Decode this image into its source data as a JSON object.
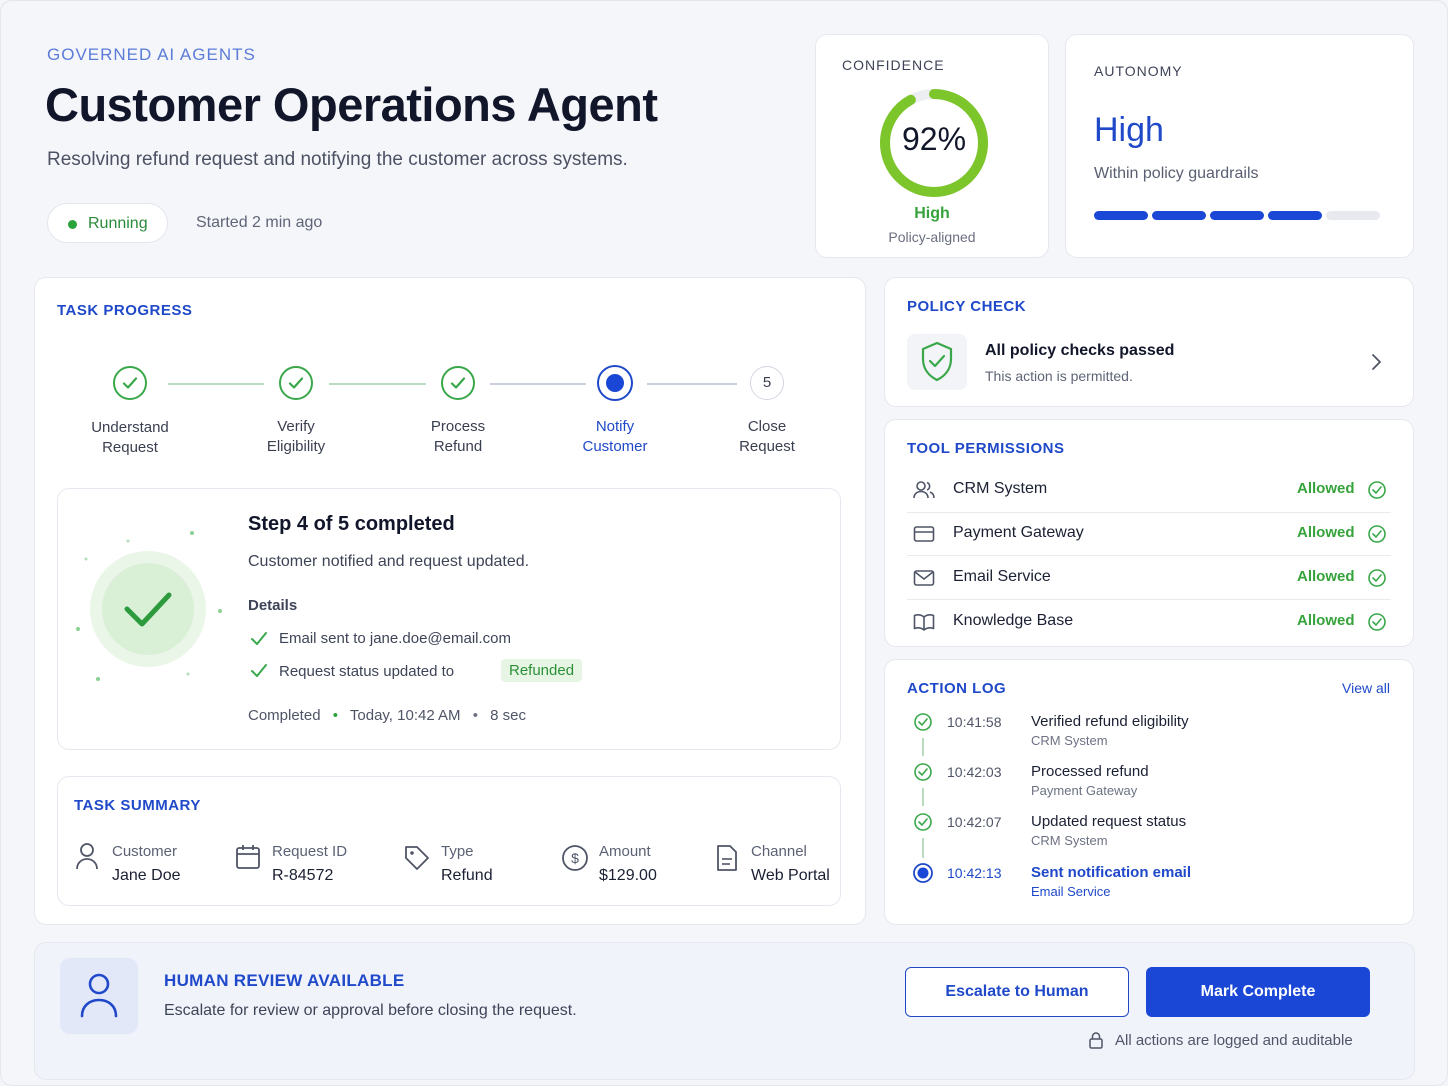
{
  "header": {
    "eyebrow": "GOVERNED AI AGENTS",
    "title": "Customer Operations Agent",
    "subtitle": "Resolving refund request and notifying the customer across systems.",
    "status": "Running",
    "started": "Started 2 min ago"
  },
  "confidence": {
    "title": "CONFIDENCE",
    "value": "92%",
    "fraction": 0.92,
    "level": "High",
    "sub": "Policy-aligned"
  },
  "autonomy": {
    "title": "AUTONOMY",
    "value": "High",
    "sub": "Within policy guardrails",
    "segments_filled": 4,
    "segments_total": 5
  },
  "progress": {
    "title": "TASK PROGRESS",
    "steps": [
      {
        "line1": "Understand",
        "line2": "Request",
        "state": "done"
      },
      {
        "line1": "Verify",
        "line2": "Eligibility",
        "state": "done"
      },
      {
        "line1": "Process",
        "line2": "Refund",
        "state": "done"
      },
      {
        "line1": "Notify",
        "line2": "Customer",
        "state": "active"
      },
      {
        "line1": "Close",
        "line2": "Request",
        "state": "pending",
        "number": "5"
      }
    ],
    "detail": {
      "heading": "Step 4 of 5 completed",
      "desc": "Customer notified and request updated.",
      "details_label": "Details",
      "item1": "Email sent to jane.doe@email.com",
      "item2": "Request status updated to",
      "item2_badge": "Refunded",
      "completed": "Completed",
      "time": "Today, 10:42 AM",
      "duration": "8 sec"
    }
  },
  "summary": {
    "title": "TASK SUMMARY",
    "customer_label": "Customer",
    "customer_value": "Jane Doe",
    "request_label": "Request ID",
    "request_value": "R-84572",
    "type_label": "Type",
    "type_value": "Refund",
    "amount_label": "Amount",
    "amount_value": "$129.00",
    "channel_label": "Channel",
    "channel_value": "Web Portal"
  },
  "policy": {
    "title": "POLICY CHECK",
    "heading": "All policy checks passed",
    "sub": "This action is permitted."
  },
  "tools": {
    "title": "TOOL PERMISSIONS",
    "items": [
      {
        "name": "CRM System",
        "status": "Allowed"
      },
      {
        "name": "Payment Gateway",
        "status": "Allowed"
      },
      {
        "name": "Email Service",
        "status": "Allowed"
      },
      {
        "name": "Knowledge Base",
        "status": "Allowed"
      }
    ]
  },
  "log": {
    "title": "ACTION LOG",
    "view_all": "View all",
    "entries": [
      {
        "time": "10:41:58",
        "title": "Verified refund eligibility",
        "system": "CRM System"
      },
      {
        "time": "10:42:03",
        "title": "Processed refund",
        "system": "Payment Gateway"
      },
      {
        "time": "10:42:07",
        "title": "Updated request status",
        "system": "CRM System"
      },
      {
        "time": "10:42:13",
        "title": "Sent notification email",
        "system": "Email Service"
      }
    ]
  },
  "review": {
    "title": "HUMAN REVIEW AVAILABLE",
    "sub": "Escalate for review or approval before closing the request.",
    "escalate": "Escalate to Human",
    "complete": "Mark Complete",
    "audit": "All actions are logged and auditable"
  },
  "colors": {
    "accent": "#1f49c9",
    "success": "#3aa84a",
    "ring": "#7cc52a"
  }
}
